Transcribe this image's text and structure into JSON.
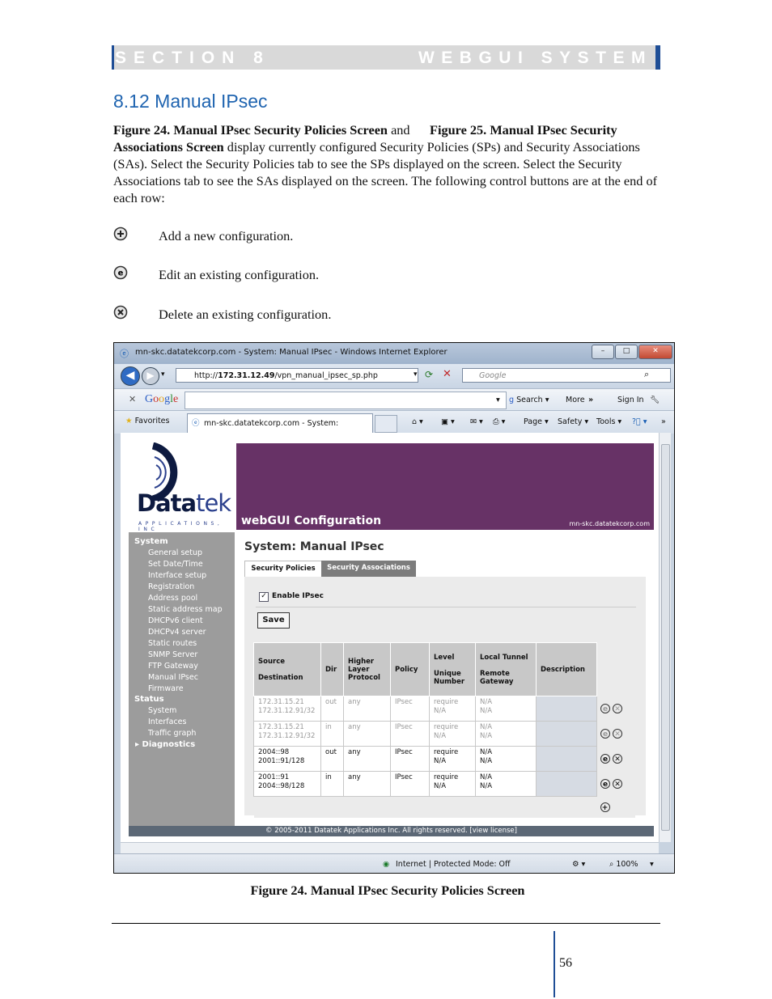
{
  "header": {
    "section": "SECTION 8",
    "title": "WEBGUI SYSTEM"
  },
  "heading": "8.12 Manual IPsec",
  "intro": {
    "fig24_ref": "Figure 24. Manual IPsec Security Policies Screen",
    "and": " and",
    "fig25_ref": "Figure 25. Manual IPsec Security Associations Screen",
    "text": " display currently configured Security Policies (SPs) and Security Associations (SAs).  Select the Security Policies tab to see the SPs displayed on the screen.  Select the Security Associations tab to see the SAs displayed on the screen. The following control buttons are at the end of each row:"
  },
  "controls": [
    {
      "icon": "add-icon",
      "label": "Add a new configuration."
    },
    {
      "icon": "edit-icon",
      "label": "Edit an existing configuration."
    },
    {
      "icon": "delete-icon",
      "label": "Delete an existing configuration."
    }
  ],
  "browser": {
    "window_title": "mn-skc.datatekcorp.com - System: Manual IPsec - Windows Internet Explorer",
    "url_prefix": "http://",
    "url_host": "172.31.12.49",
    "url_path": "/vpn_manual_ipsec_sp.php",
    "search_placeholder": "Google",
    "google_label": "Google",
    "google_search": "Search",
    "google_more": "More",
    "google_signin": "Sign In",
    "favorites": "Favorites",
    "tab_title": "mn-skc.datatekcorp.com - System: Manual...",
    "page_menu": "Page",
    "safety_menu": "Safety",
    "tools_menu": "Tools",
    "status_text": "Internet | Protected Mode: Off",
    "zoom": "100%"
  },
  "app": {
    "logo_main": "Data",
    "logo_accent": "tek",
    "logo_sub": "APPLICATIONS, INC",
    "banner_title": "webGUI Configuration",
    "banner_host": "mn-skc.datatekcorp.com",
    "page_title": "System: Manual IPsec",
    "tabs": [
      "Security Policies",
      "Security Associations"
    ],
    "enable_label": "Enable IPsec",
    "save_label": "Save",
    "footer": "© 2005-2011 Datatek Applications Inc. All rights reserved.  [view license]",
    "sidebar": {
      "system_label": "System",
      "system_items": [
        "General setup",
        "Set Date/Time",
        "Interface setup",
        "Registration",
        "Address pool",
        "Static address map",
        "DHCPv6 client",
        "DHCPv4 server",
        "Static routes",
        "SNMP Server",
        "FTP Gateway",
        "Manual IPsec",
        "Firmware"
      ],
      "status_label": "Status",
      "status_items": [
        "System",
        "Interfaces",
        "Traffic graph"
      ],
      "diagnostics_label": "Diagnostics"
    },
    "table": {
      "headers": {
        "source": "Source",
        "destination": "Destination",
        "dir": "Dir",
        "hlp": "Higher Layer Protocol",
        "policy": "Policy",
        "level": "Level",
        "unique": "Unique Number",
        "local_tunnel": "Local Tunnel",
        "remote_gateway": "Remote Gateway",
        "description": "Description"
      },
      "rows": [
        {
          "src": "172.31.15.21",
          "dst": "172.31.12.91/32",
          "dir": "out",
          "proto": "any",
          "policy": "IPsec",
          "level": "require",
          "unique": "N/A",
          "local": "N/A",
          "remote": "N/A",
          "desc": ""
        },
        {
          "src": "172.31.15.21",
          "dst": "172.31.12.91/32",
          "dir": "in",
          "proto": "any",
          "policy": "IPsec",
          "level": "require",
          "unique": "N/A",
          "local": "N/A",
          "remote": "N/A",
          "desc": ""
        },
        {
          "src": "2004::98",
          "dst": "2001::91/128",
          "dir": "out",
          "proto": "any",
          "policy": "IPsec",
          "level": "require",
          "unique": "N/A",
          "local": "N/A",
          "remote": "N/A",
          "desc": ""
        },
        {
          "src": "2001::91",
          "dst": "2004::98/128",
          "dir": "in",
          "proto": "any",
          "policy": "IPsec",
          "level": "require",
          "unique": "N/A",
          "local": "N/A",
          "remote": "N/A",
          "desc": ""
        }
      ]
    }
  },
  "caption": "Figure 24. Manual IPsec Security Policies Screen",
  "page_number": "56"
}
